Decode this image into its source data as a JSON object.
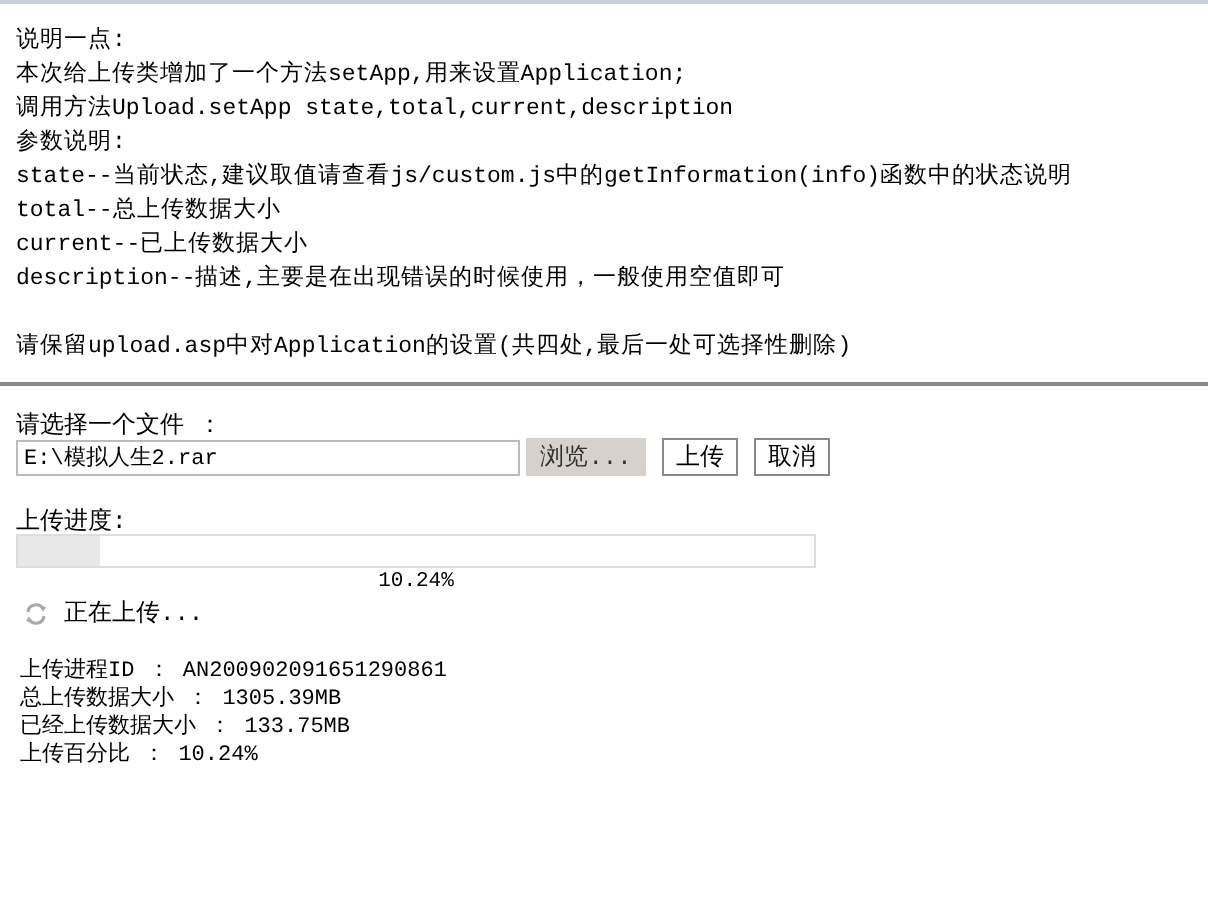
{
  "notes": {
    "lines": [
      "说明一点:",
      "本次给上传类增加了一个方法setApp,用来设置Application;",
      "调用方法Upload.setApp state,total,current,description",
      "参数说明:",
      "state--当前状态,建议取值请查看js/custom.js中的getInformation(info)函数中的状态说明",
      "total--总上传数据大小",
      "current--已上传数据大小",
      "description--描述,主要是在出现错误的时候使用，一般使用空值即可"
    ],
    "remark": "请保留upload.asp中对Application的设置(共四处,最后一处可选择性删除)"
  },
  "form": {
    "label": "请选择一个文件 ：",
    "file_field": {
      "value": "E:\\模拟人生2.rar"
    },
    "buttons": [
      {
        "label": "浏览...",
        "kind": "browse"
      },
      {
        "label": "上传",
        "kind": "plain"
      },
      {
        "label": "取消",
        "kind": "plain"
      }
    ]
  },
  "progress": {
    "label": "上传进度:",
    "level": 0.1024,
    "reading": "10.24%",
    "status": "正在上传..."
  },
  "info": [
    "上传进程ID ： AN200902091651290861",
    "总上传数据大小 ： 1305.39MB",
    "已经上传数据大小 ： 133.75MB",
    "上传百分比 ： 10.24%"
  ]
}
